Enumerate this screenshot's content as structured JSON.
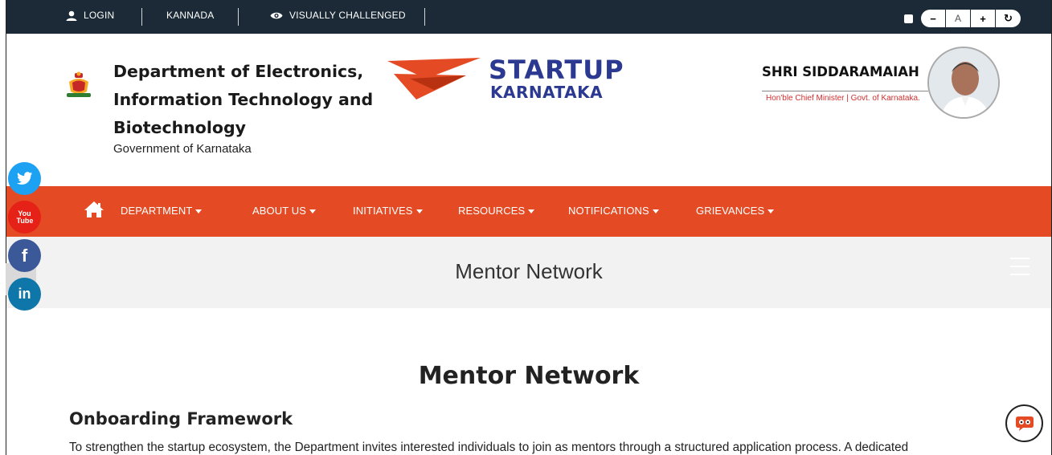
{
  "topbar": {
    "login": "LOGIN",
    "language": "KANNADA",
    "visually_challenged": "VISUALLY CHALLENGED",
    "font_decrease": "−",
    "font_reset": "A",
    "font_increase": "+",
    "reset": "↻"
  },
  "header": {
    "dept_title": "Department of Electronics, Information Technology and Biotechnology",
    "dept_sub": "Government of Karnataka",
    "logo_line1": "STARTUP",
    "logo_line2": "KARNATAKA",
    "cm_name": "SHRI SIDDARAMAIAH",
    "cm_title": "Hon'ble Chief Minister | Govt. of Karnataka."
  },
  "nav": {
    "items": [
      {
        "label": "DEPARTMENT"
      },
      {
        "label": "ABOUT US"
      },
      {
        "label": "INITIATIVES"
      },
      {
        "label": "RESOURCES"
      },
      {
        "label": "NOTIFICATIONS"
      },
      {
        "label": "GRIEVANCES"
      }
    ]
  },
  "page": {
    "banner_title": "Mentor Network",
    "heading": "Mentor Network",
    "subheading": "Onboarding Framework",
    "paragraph": "To strengthen the startup ecosystem, the Department invites interested individuals to join as mentors through a structured application process. A dedicated"
  },
  "social": {
    "twitter_color": "#1da1f2",
    "youtube_color": "#e62117",
    "facebook_color": "#3b5998",
    "linkedin_color": "#0e76a8",
    "youtube_label": "You Tube",
    "facebook_label": "f",
    "linkedin_label": "in"
  },
  "colors": {
    "topbar": "#1b2a36",
    "nav": "#e44b24",
    "logo_blue": "#2b3990",
    "logo_red": "#e44b24"
  }
}
